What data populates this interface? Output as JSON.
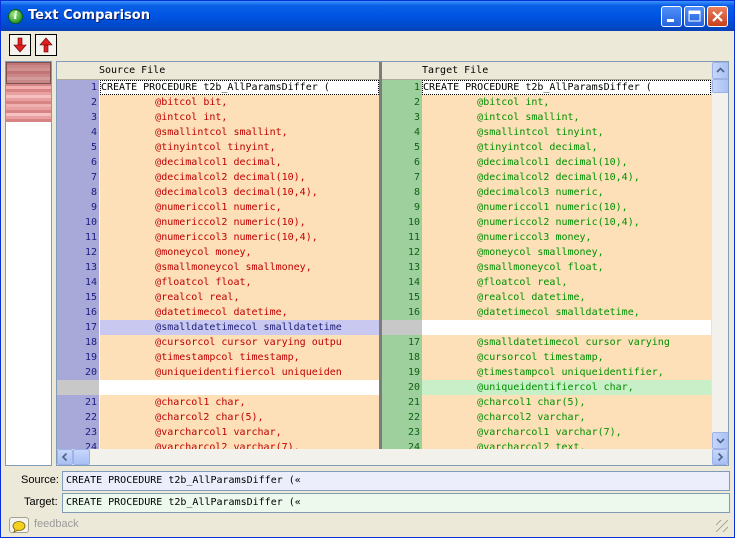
{
  "window": {
    "title": "Text Comparison"
  },
  "colors": {
    "ln_left": "#a9a9d9",
    "ln_right": "#9ed09e",
    "diff_bg": "#fde0b8",
    "ins_left_bg": "#c8c8f0",
    "ins_right_bg": "#c8efc8",
    "src_text": "#c00000",
    "tgt_text": "#009000"
  },
  "toolbar": {
    "next_diff": "next-diff-arrow",
    "prev_diff": "prev-diff-arrow"
  },
  "grid": {
    "source_header": "Source File",
    "target_header": "Target File",
    "source_lines": [
      {
        "n": "1",
        "t": "CREATE PROCEDURE t2b_AllParamsDiffer (",
        "kind": "first"
      },
      {
        "n": "2",
        "t": "         @bitcol bit,",
        "kind": "diff"
      },
      {
        "n": "3",
        "t": "         @intcol int,",
        "kind": "diff"
      },
      {
        "n": "4",
        "t": "         @smallintcol smallint,",
        "kind": "diff"
      },
      {
        "n": "5",
        "t": "         @tinyintcol tinyint,",
        "kind": "diff"
      },
      {
        "n": "6",
        "t": "         @decimalcol1 decimal,",
        "kind": "diff"
      },
      {
        "n": "7",
        "t": "         @decimalcol2 decimal(10),",
        "kind": "diff"
      },
      {
        "n": "8",
        "t": "         @decimalcol3 decimal(10,4),",
        "kind": "diff"
      },
      {
        "n": "9",
        "t": "         @numericcol1 numeric,",
        "kind": "diff"
      },
      {
        "n": "10",
        "t": "         @numericcol2 numeric(10),",
        "kind": "diff"
      },
      {
        "n": "11",
        "t": "         @numericcol3 numeric(10,4),",
        "kind": "diff"
      },
      {
        "n": "12",
        "t": "         @moneycol money,",
        "kind": "diff"
      },
      {
        "n": "13",
        "t": "         @smallmoneycol smallmoney,",
        "kind": "diff"
      },
      {
        "n": "14",
        "t": "         @floatcol float,",
        "kind": "diff"
      },
      {
        "n": "15",
        "t": "         @realcol real,",
        "kind": "diff"
      },
      {
        "n": "16",
        "t": "         @datetimecol datetime,",
        "kind": "diff"
      },
      {
        "n": "17",
        "t": "         @smalldatetimecol smalldatetime",
        "kind": "only"
      },
      {
        "n": "18",
        "t": "         @cursorcol cursor varying outpu",
        "kind": "diff"
      },
      {
        "n": "19",
        "t": "         @timestampcol timestamp,",
        "kind": "diff"
      },
      {
        "n": "20",
        "t": "         @uniqueidentifiercol uniqueiden",
        "kind": "diff"
      },
      {
        "n": "",
        "t": "",
        "kind": "gap"
      },
      {
        "n": "21",
        "t": "         @charcol1 char,",
        "kind": "diff"
      },
      {
        "n": "22",
        "t": "         @charcol2 char(5),",
        "kind": "diff"
      },
      {
        "n": "23",
        "t": "         @varcharcol1 varchar,",
        "kind": "diff"
      },
      {
        "n": "24",
        "t": "         @varcharcol2 varchar(7),",
        "kind": "diff"
      }
    ],
    "target_lines": [
      {
        "n": "1",
        "t": "CREATE PROCEDURE t2b_AllParamsDiffer (",
        "kind": "first"
      },
      {
        "n": "2",
        "t": "         @bitcol int,",
        "kind": "diff"
      },
      {
        "n": "3",
        "t": "         @intcol smallint,",
        "kind": "diff"
      },
      {
        "n": "4",
        "t": "         @smallintcol tinyint,",
        "kind": "diff"
      },
      {
        "n": "5",
        "t": "         @tinyintcol decimal,",
        "kind": "diff"
      },
      {
        "n": "6",
        "t": "         @decimalcol1 decimal(10),",
        "kind": "diff"
      },
      {
        "n": "7",
        "t": "         @decimalcol2 decimal(10,4),",
        "kind": "diff"
      },
      {
        "n": "8",
        "t": "         @decimalcol3 numeric,",
        "kind": "diff"
      },
      {
        "n": "9",
        "t": "         @numericcol1 numeric(10),",
        "kind": "diff"
      },
      {
        "n": "10",
        "t": "         @numericcol2 numeric(10,4),",
        "kind": "diff"
      },
      {
        "n": "11",
        "t": "         @numericcol3 money,",
        "kind": "diff"
      },
      {
        "n": "12",
        "t": "         @moneycol smallmoney,",
        "kind": "diff"
      },
      {
        "n": "13",
        "t": "         @smallmoneycol float,",
        "kind": "diff"
      },
      {
        "n": "14",
        "t": "         @floatcol real,",
        "kind": "diff"
      },
      {
        "n": "15",
        "t": "         @realcol datetime,",
        "kind": "diff"
      },
      {
        "n": "16",
        "t": "         @datetimecol smalldatetime,",
        "kind": "diff"
      },
      {
        "n": "",
        "t": "",
        "kind": "gap"
      },
      {
        "n": "17",
        "t": "         @smalldatetimecol cursor varying",
        "kind": "diff"
      },
      {
        "n": "18",
        "t": "         @cursorcol timestamp,",
        "kind": "diff"
      },
      {
        "n": "19",
        "t": "         @timestampcol uniqueidentifier,",
        "kind": "diff"
      },
      {
        "n": "20",
        "t": "         @uniqueidentifiercol char,",
        "kind": "only"
      },
      {
        "n": "21",
        "t": "         @charcol1 char(5),",
        "kind": "diff"
      },
      {
        "n": "22",
        "t": "         @charcol2 varchar,",
        "kind": "diff"
      },
      {
        "n": "23",
        "t": "         @varcharcol1 varchar(7),",
        "kind": "diff"
      },
      {
        "n": "24",
        "t": "         @varcharcol2 text,",
        "kind": "diff"
      }
    ]
  },
  "bottom": {
    "source_label": "Source:",
    "source_value": "CREATE PROCEDURE t2b_AllParamsDiffer («",
    "target_label": "Target:",
    "target_value": "CREATE PROCEDURE t2b_AllParamsDiffer («"
  },
  "status": {
    "feedback_label": "feedback",
    "feedback_icon": "chat-bubble-icon"
  }
}
